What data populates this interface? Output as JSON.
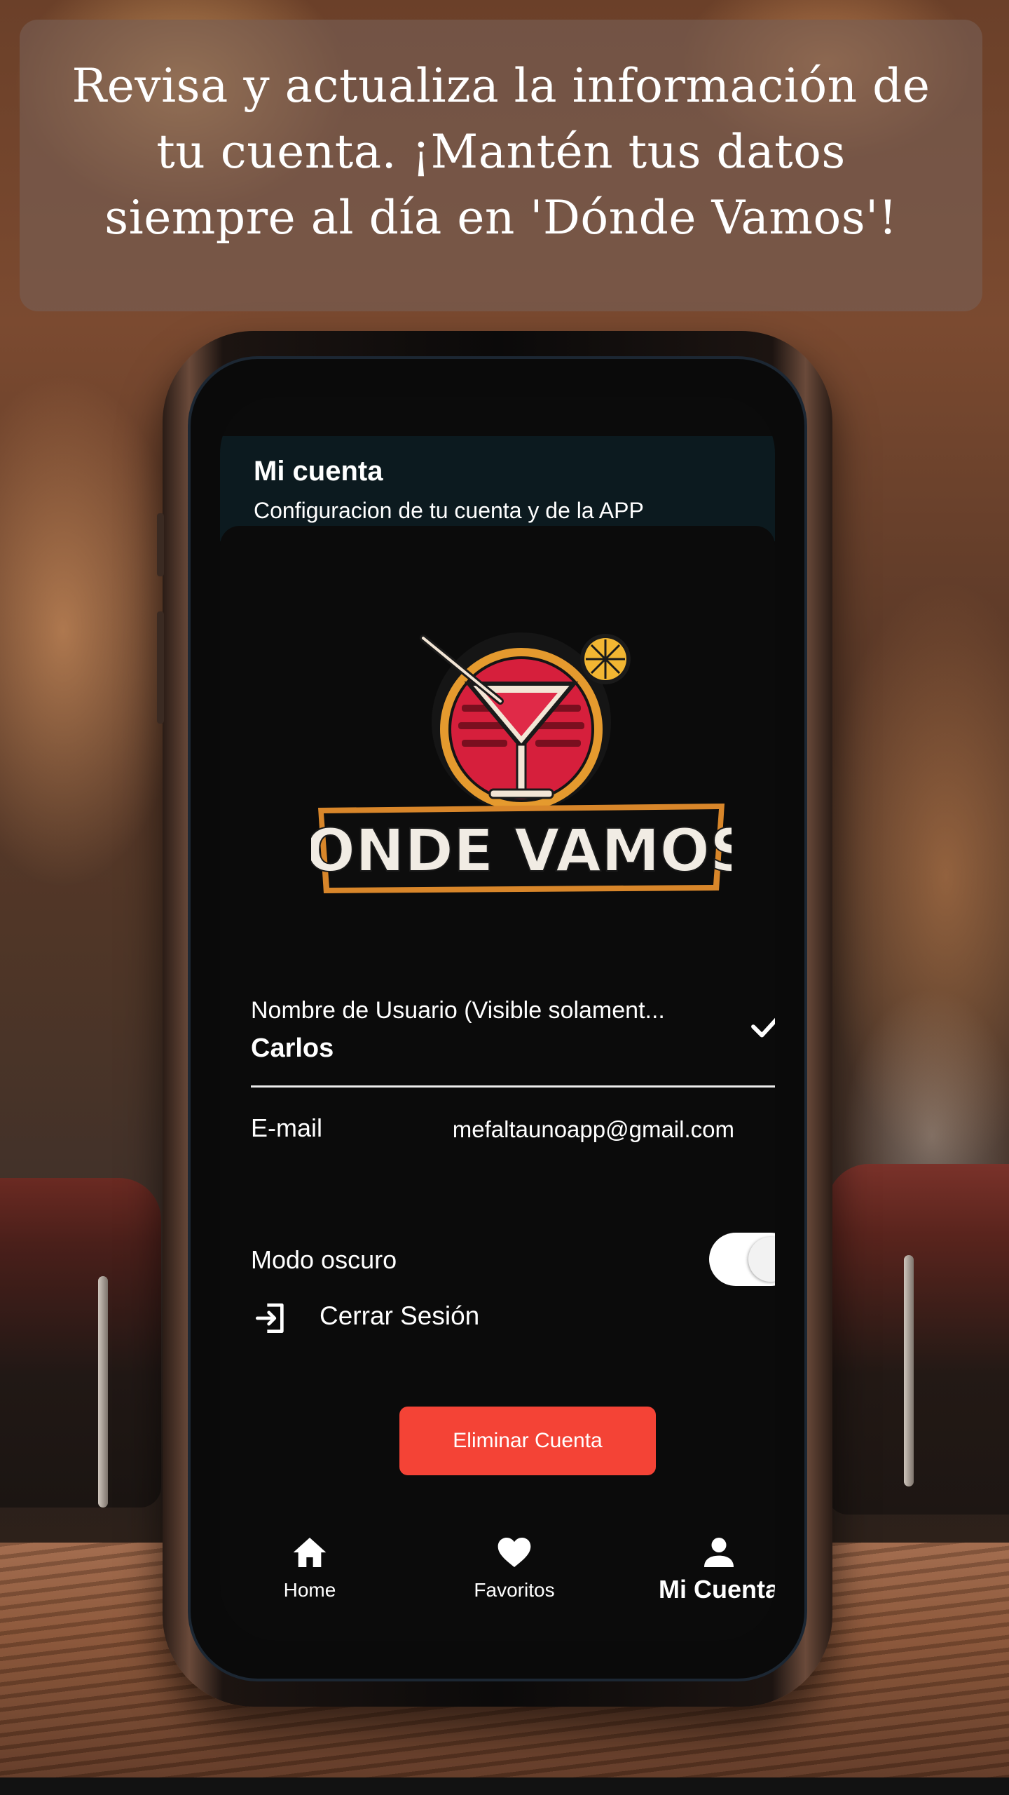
{
  "caption": {
    "text": "Revisa y actualiza la información de tu cuenta. ¡Mantén tus datos siempre al día en 'Dónde Vamos'!"
  },
  "app": {
    "header": {
      "title": "Mi cuenta",
      "subtitle": "Configuracion de tu cuenta y de la APP"
    },
    "logo": {
      "text": "DONDE VAMOS?",
      "icon": "cocktail-glass-icon"
    },
    "username_field": {
      "label": "Nombre de Usuario (Visible solament...",
      "value": "Carlos",
      "icon": "check-icon"
    },
    "email": {
      "label": "E-mail",
      "value": "mefaltaunoapp@gmail.com"
    },
    "dark_mode": {
      "label": "Modo oscuro",
      "enabled": true
    },
    "logout": {
      "label": "Cerrar Sesión",
      "icon": "logout-icon"
    },
    "delete_button": {
      "label": "Eliminar Cuenta",
      "color": "#f44336"
    },
    "bottom_nav": {
      "items": [
        {
          "label": "Home",
          "icon": "home-icon",
          "active": false
        },
        {
          "label": "Favoritos",
          "icon": "heart-icon",
          "active": false
        },
        {
          "label": "Mi Cuenta",
          "icon": "person-icon",
          "active": true
        }
      ]
    }
  },
  "colors": {
    "screen_background": "#0b0b0b",
    "header_background": "#0c1a1f",
    "accent_red": "#f44336"
  }
}
